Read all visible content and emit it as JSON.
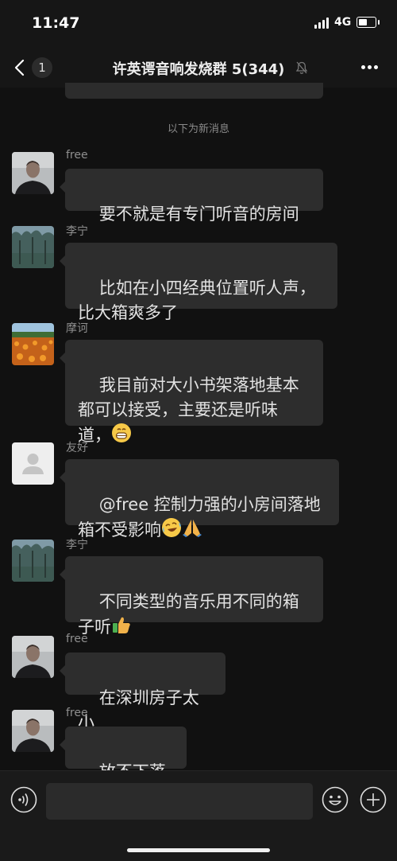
{
  "status_bar": {
    "time": "11:47",
    "network": "4G"
  },
  "header": {
    "back_count": "1",
    "title": "许英谔音响发烧群 5(344)"
  },
  "divider_label": "以下为新消息",
  "messages": [
    {
      "sender": "free",
      "avatar": "portrait-man",
      "text": "要不就是有专门听音的房间"
    },
    {
      "sender": "李宁",
      "avatar": "forest-landscape",
      "text": "比如在小四经典位置听人声，\n比大箱爽多了"
    },
    {
      "sender": "摩诃",
      "avatar": "flower-field",
      "text": "我目前对大小书架落地基本\n都可以接受，主要还是听味\n道，"
    },
    {
      "sender": "友好",
      "avatar": "default-user",
      "text": "@free 控制力强的小房间落地\n箱不受影响"
    },
    {
      "sender": "李宁",
      "avatar": "forest-landscape",
      "text": "不同类型的音乐用不同的箱\n子听"
    },
    {
      "sender": "free",
      "avatar": "portrait-man",
      "text": "在深圳房子太小"
    },
    {
      "sender": "free",
      "avatar": "portrait-man",
      "text": "放不下落地"
    }
  ],
  "colors": {
    "background": "#111111",
    "bubble": "#2d2d2d",
    "bar": "#161616"
  }
}
